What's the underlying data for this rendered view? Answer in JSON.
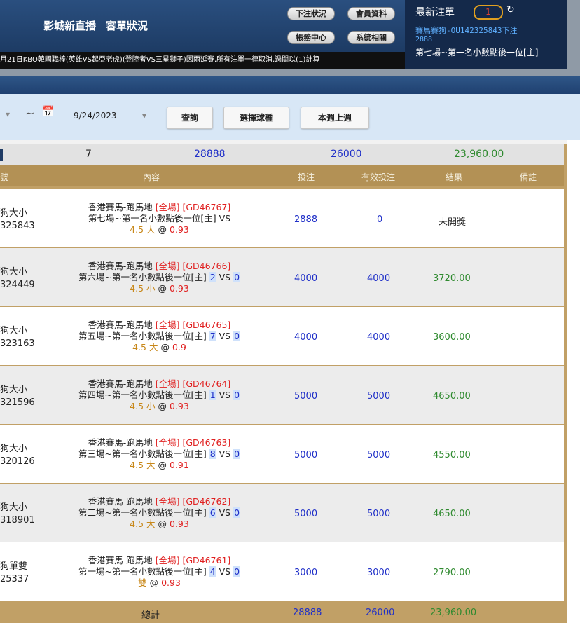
{
  "header": {
    "nav": [
      "影城",
      "新直播",
      "審單狀況"
    ],
    "buttons": [
      "下注狀況",
      "會員資料",
      "帳務中心",
      "系統相關"
    ]
  },
  "latest": {
    "title": "最新注單",
    "count": "1",
    "refresh_glyph": "↻",
    "line1": "賽馬賽狗-OU142325843下注",
    "line2": "2888",
    "line3": "第七場~第一名小數點後一位[主]"
  },
  "ticker": "月21日KBO韓國職棒(英雄VS起亞老虎)(登陸者VS三星獅子)因雨延賽,所有注單一律取消,過關以(1)計算",
  "filter": {
    "dropdown_glyph": "▾",
    "tilde": "~",
    "calendar_glyph": "📅",
    "date_end": "9/24/2023",
    "buttons": [
      "查詢",
      "選擇球種",
      "本週上週"
    ]
  },
  "summary": {
    "count": "7",
    "bet": "28888",
    "valid": "26000",
    "result": "23,960.00"
  },
  "table": {
    "headers": [
      "號",
      "內容",
      "投注",
      "有效投注",
      "結果",
      "備註"
    ],
    "rows": [
      {
        "type": "狗大小",
        "code": "325843",
        "line1": "香港賽馬-跑馬地",
        "scope": "[全場]",
        "gid": "[GD46767]",
        "line2": "第七場~第一名小數點後一位[主] VS",
        "a": "",
        "b": "",
        "handicap": "4.5",
        "pick": "大",
        "at": "@",
        "odds": "0.93",
        "bet": "2888",
        "valid": "0",
        "result": "未開獎"
      },
      {
        "type": "狗大小",
        "code": "324449",
        "line1": "香港賽馬-跑馬地",
        "scope": "[全場]",
        "gid": "[GD46766]",
        "line2": "第六場~第一名小數點後一位[主]",
        "a": "2",
        "b": "0",
        "handicap": "4.5",
        "pick": "小",
        "at": "@",
        "odds": "0.93",
        "bet": "4000",
        "valid": "4000",
        "result": "3720.00"
      },
      {
        "type": "狗大小",
        "code": "323163",
        "line1": "香港賽馬-跑馬地",
        "scope": "[全場]",
        "gid": "[GD46765]",
        "line2": "第五場~第一名小數點後一位[主]",
        "a": "7",
        "b": "0",
        "handicap": "4.5",
        "pick": "大",
        "at": "@",
        "odds": "0.9",
        "bet": "4000",
        "valid": "4000",
        "result": "3600.00"
      },
      {
        "type": "狗大小",
        "code": "321596",
        "line1": "香港賽馬-跑馬地",
        "scope": "[全場]",
        "gid": "[GD46764]",
        "line2": "第四場~第一名小數點後一位[主]",
        "a": "1",
        "b": "0",
        "handicap": "4.5",
        "pick": "小",
        "at": "@",
        "odds": "0.93",
        "bet": "5000",
        "valid": "5000",
        "result": "4650.00"
      },
      {
        "type": "狗大小",
        "code": "320126",
        "line1": "香港賽馬-跑馬地",
        "scope": "[全場]",
        "gid": "[GD46763]",
        "line2": "第三場~第一名小數點後一位[主]",
        "a": "8",
        "b": "0",
        "handicap": "4.5",
        "pick": "大",
        "at": "@",
        "odds": "0.91",
        "bet": "5000",
        "valid": "5000",
        "result": "4550.00"
      },
      {
        "type": "狗大小",
        "code": "318901",
        "line1": "香港賽馬-跑馬地",
        "scope": "[全場]",
        "gid": "[GD46762]",
        "line2": "第二場~第一名小數點後一位[主]",
        "a": "6",
        "b": "0",
        "handicap": "4.5",
        "pick": "大",
        "at": "@",
        "odds": "0.93",
        "bet": "5000",
        "valid": "5000",
        "result": "4650.00"
      },
      {
        "type": "狗單雙",
        "code": "25337",
        "line1": "香港賽馬-跑馬地",
        "scope": "[全場]",
        "gid": "[GD46761]",
        "line2": "第一場~第一名小數點後一位[主]",
        "a": "4",
        "b": "0",
        "handicap": "",
        "pick": "雙",
        "at": "@",
        "odds": "0.93",
        "bet": "3000",
        "valid": "3000",
        "result": "2790.00"
      }
    ]
  },
  "footer": {
    "label": "總計",
    "bet": "28888",
    "valid": "26000",
    "result": "23,960.00"
  }
}
